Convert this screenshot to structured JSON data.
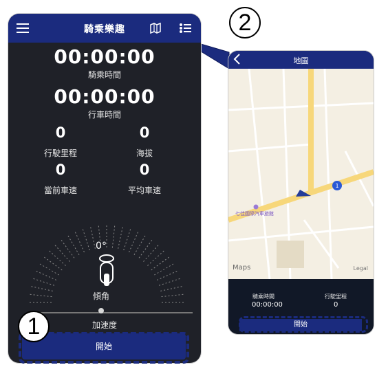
{
  "callouts": {
    "one": "1",
    "two": "2"
  },
  "phone1": {
    "topbar": {
      "title": "騎乘樂趣",
      "icons": [
        "hamburger-menu-icon",
        "map-icon",
        "list-icon"
      ]
    },
    "ride_time": {
      "value": "00:00:00",
      "label": "騎乘時間"
    },
    "drive_time": {
      "value": "00:00:00",
      "label": "行車時間"
    },
    "stats": [
      {
        "value": "0",
        "label": "行駛里程"
      },
      {
        "value": "0",
        "label": "海拔"
      },
      {
        "value": "0",
        "label": "當前車速"
      },
      {
        "value": "0",
        "label": "平均車速"
      }
    ],
    "lean": {
      "value": "0°",
      "label": "傾角"
    },
    "acceleration": {
      "label": "加速度",
      "level": 0.5
    },
    "start_button_label": "開始",
    "colors": {
      "accent": "#1b2b7e",
      "background": "#1f2128"
    }
  },
  "phone2": {
    "topbar": {
      "title": "地圖"
    },
    "map": {
      "poi_labels": [
        "七佳國際汽車旅館"
      ],
      "road_shield": "1",
      "attribution": "Maps",
      "legal": "Legal"
    },
    "stats": [
      {
        "label": "騎乘時間",
        "value": "00:00:00"
      },
      {
        "label": "行駛里程",
        "value": "0"
      }
    ],
    "start_button_label": "開始"
  }
}
